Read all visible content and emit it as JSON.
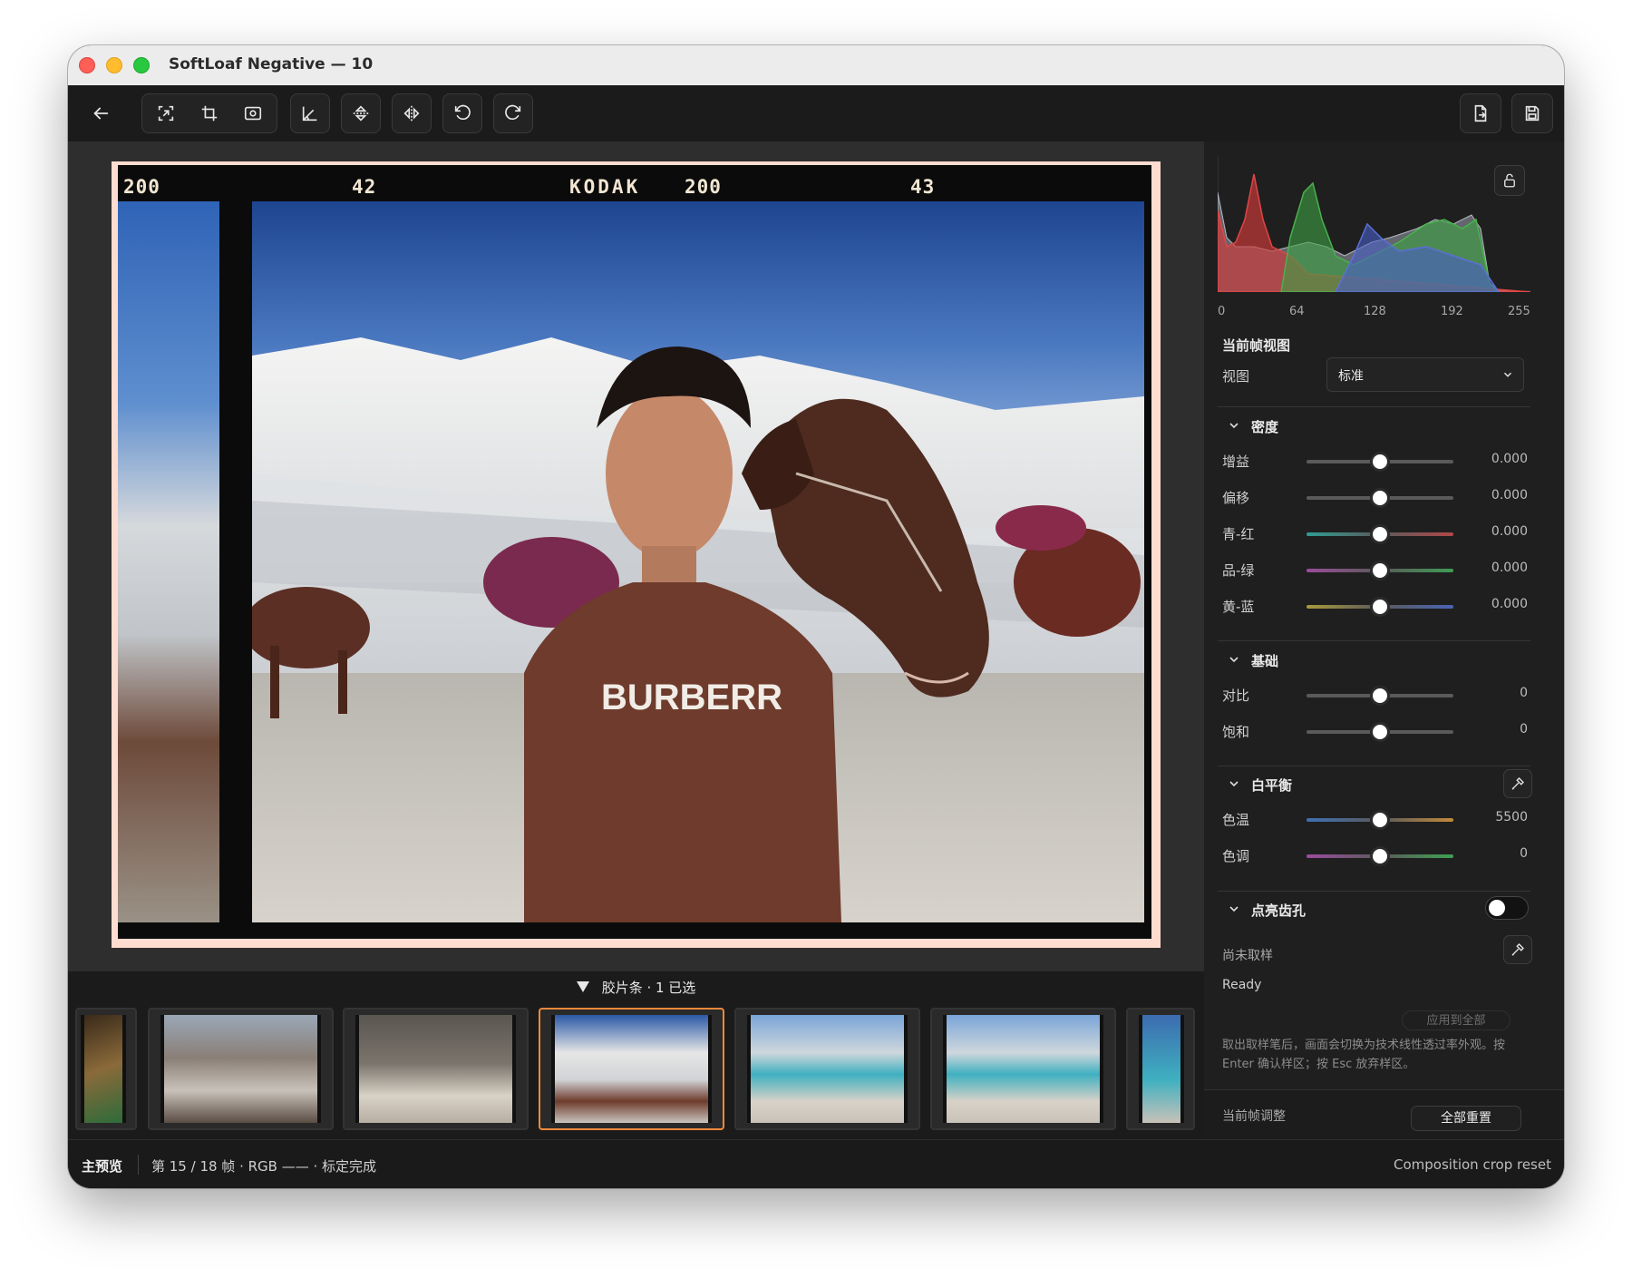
{
  "window": {
    "title": "SoftLoaf Negative — 10"
  },
  "toolbar": {
    "buttons": [
      {
        "name": "back",
        "icon": "arrow-left-icon"
      },
      {
        "name": "focus",
        "icon": "focus-icon"
      },
      {
        "name": "crop",
        "icon": "crop-icon"
      },
      {
        "name": "frame-detect",
        "icon": "frame-icon"
      },
      {
        "name": "angle",
        "icon": "angle-icon"
      },
      {
        "name": "flip-vertical",
        "icon": "flip-vertical-icon"
      },
      {
        "name": "flip-horizontal",
        "icon": "flip-horizontal-icon"
      },
      {
        "name": "rotate-left",
        "icon": "rotate-left-icon"
      },
      {
        "name": "rotate-right",
        "icon": "rotate-right-icon"
      },
      {
        "name": "export",
        "icon": "export-file-icon"
      },
      {
        "name": "save",
        "icon": "save-icon"
      }
    ]
  },
  "film": {
    "edge_texts": [
      "200",
      "42",
      "KODAK",
      "200",
      "43"
    ],
    "shirt_text": "BURBERR"
  },
  "filmstrip": {
    "header": "胶片条 · 1 已选",
    "selected_index": 3,
    "thumb_count": 7
  },
  "histogram": {
    "labels": [
      "0",
      "64",
      "128",
      "192",
      "255"
    ],
    "colors": {
      "red": "#d23b3b",
      "green": "#3da142",
      "blue": "#4a5fc8",
      "luma": "#9aa1ad"
    }
  },
  "view": {
    "section_title": "当前帧视图",
    "label": "视图",
    "selected": "标准"
  },
  "density": {
    "title": "密度",
    "rows": [
      {
        "label": "增益",
        "value": "0.000",
        "pos": 0.5
      },
      {
        "label": "偏移",
        "value": "0.000",
        "pos": 0.5
      },
      {
        "label": "青-红",
        "value": "0.000",
        "pos": 0.5
      },
      {
        "label": "品-绿",
        "value": "0.000",
        "pos": 0.5
      },
      {
        "label": "黄-蓝",
        "value": "0.000",
        "pos": 0.5
      }
    ]
  },
  "basic": {
    "title": "基础",
    "rows": [
      {
        "label": "对比",
        "value": "0",
        "pos": 0.5
      },
      {
        "label": "饱和",
        "value": "0",
        "pos": 0.5
      }
    ]
  },
  "white_balance": {
    "title": "白平衡",
    "rows": [
      {
        "label": "色温",
        "value": "5500",
        "pos": 0.5
      },
      {
        "label": "色调",
        "value": "0",
        "pos": 0.5
      }
    ]
  },
  "sprocket": {
    "title": "点亮齿孔",
    "enabled": false,
    "sample_status": "尚未取样",
    "status": "Ready",
    "apply_all": "应用到全部",
    "hint": "取出取样笔后，画面会切换为技术线性透过率外观。按 Enter 确认样区；按 Esc 放弃样区。"
  },
  "side_footer": {
    "label": "当前帧调整",
    "reset_all": "全部重置"
  },
  "status": {
    "mode": "主预览",
    "frame_info": "第 15 / 18 帧 · RGB —— · 标定完成",
    "right": "Composition crop reset"
  }
}
